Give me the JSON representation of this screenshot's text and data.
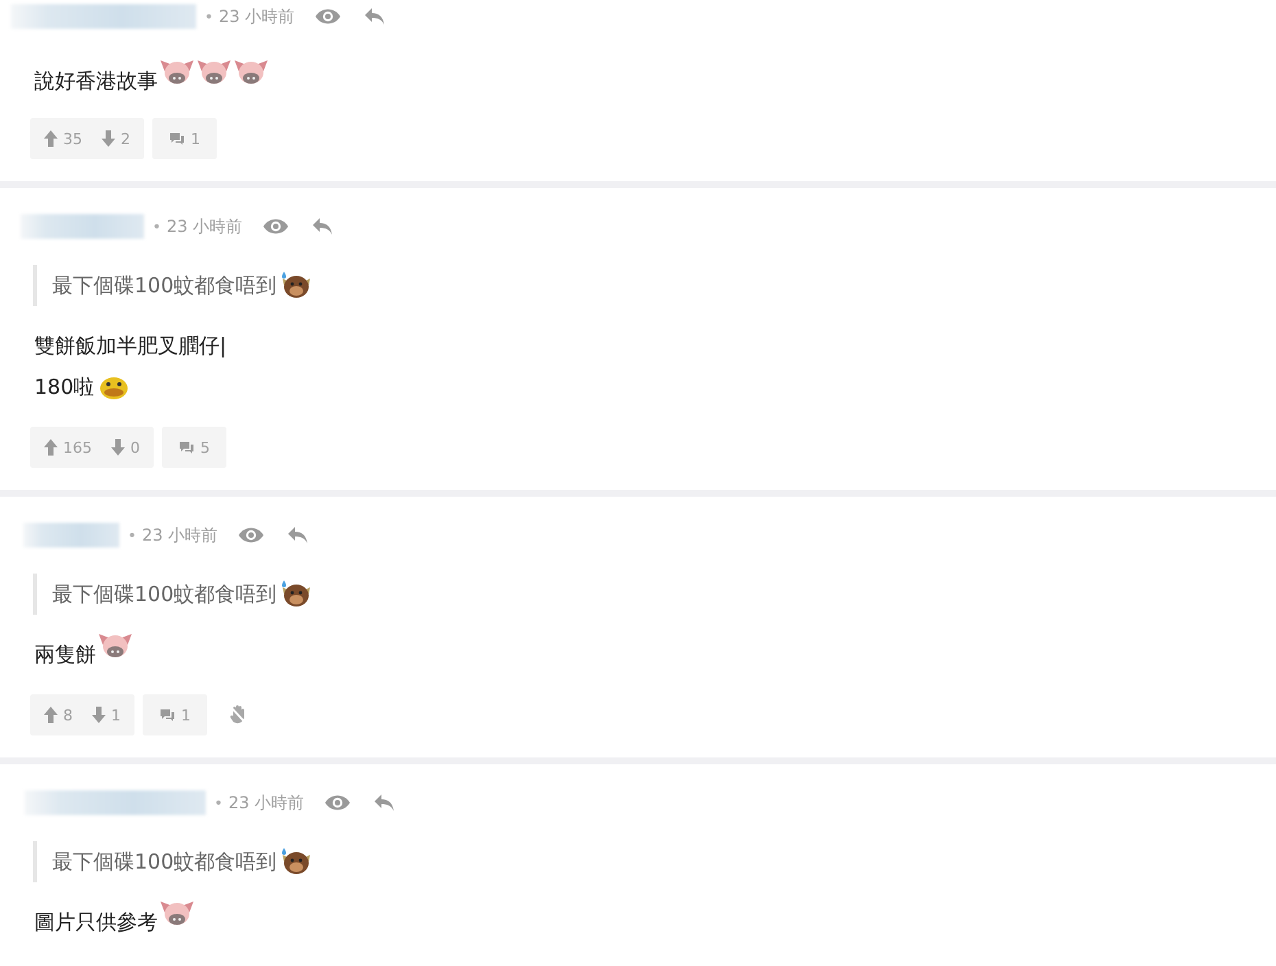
{
  "comments": [
    {
      "dot": "•",
      "time": "23 小時前",
      "lines": [
        {
          "text": "說好香港故事",
          "emojis": [
            {
              "kind": "pig"
            },
            {
              "kind": "pig"
            },
            {
              "kind": "pig"
            }
          ]
        }
      ],
      "footer": {
        "up": "35",
        "down": "2",
        "replies": "1"
      }
    },
    {
      "dot": "•",
      "time": "23 小時前",
      "quote": {
        "text": "最下個碟100蚊都食唔到",
        "emojis": [
          {
            "kind": "cow"
          }
        ]
      },
      "lines": [
        {
          "text": "雙餅飯加半肥叉膶仔|"
        },
        {
          "text": "180啦",
          "emojis": [
            {
              "kind": "duck"
            }
          ]
        }
      ],
      "footer": {
        "up": "165",
        "down": "0",
        "replies": "5"
      }
    },
    {
      "dot": "•",
      "time": "23 小時前",
      "quote": {
        "text": "最下個碟100蚊都食唔到",
        "emojis": [
          {
            "kind": "cow"
          }
        ]
      },
      "lines": [
        {
          "text": "兩隻餅",
          "emojis": [
            {
              "kind": "pig"
            }
          ]
        }
      ],
      "footer": {
        "up": "8",
        "down": "1",
        "replies": "1",
        "extra_icons": [
          {
            "kind": "hand"
          }
        ]
      }
    },
    {
      "dot": "•",
      "time": "23 小時前",
      "quote": {
        "text": "最下個碟100蚊都食唔到",
        "emojis": [
          {
            "kind": "cow"
          }
        ]
      },
      "lines": [
        {
          "text": "圖片只供參考",
          "emojis": [
            {
              "kind": "pig"
            }
          ]
        }
      ]
    }
  ]
}
